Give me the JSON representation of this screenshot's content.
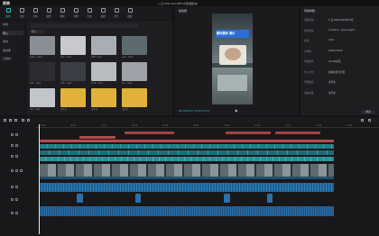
{
  "app": {
    "title": "剪映",
    "file_title": "1-云-PHN-2024年03月整理版本"
  },
  "toolbar": {
    "items": [
      {
        "label": "媒体",
        "icon": "media-icon",
        "active": true
      },
      {
        "label": "音频",
        "icon": "audio-icon"
      },
      {
        "label": "文本",
        "icon": "text-icon"
      },
      {
        "label": "贴纸",
        "icon": "sticker-icon"
      },
      {
        "label": "特效",
        "icon": "effects-icon"
      },
      {
        "label": "转场",
        "icon": "transition-icon"
      },
      {
        "label": "字幕",
        "icon": "caption-icon"
      },
      {
        "label": "滤镜",
        "icon": "filter-icon"
      },
      {
        "label": "调节",
        "icon": "adjust-icon"
      },
      {
        "label": "模板",
        "icon": "template-icon"
      }
    ]
  },
  "leftnav": {
    "items": [
      "本地",
      "导入",
      "我的",
      "素材库",
      "云素材"
    ],
    "selected_index": 1
  },
  "media": {
    "import_label": "导入",
    "thumbs": [
      {
        "name": "bdb1...mp4",
        "color": "#8a8f96"
      },
      {
        "name": "0a2...mp4",
        "color": "#c7c9cc"
      },
      {
        "name": "c89...mp4",
        "color": "#a9aeb5"
      },
      {
        "name": "ee1...mp4",
        "color": "#5d6b70"
      },
      {
        "name": "b32...mp4",
        "color": "#2b2d31"
      },
      {
        "name": "d7b...mp4",
        "color": "#3b3e44"
      },
      {
        "name": "Tm2...mp4",
        "color": "#b8bcc0"
      },
      {
        "name": "f3c...mp4",
        "color": "#9da3a9"
      },
      {
        "name": "cf0...mp4",
        "color": "#c2c6ca"
      },
      {
        "name": "文件夹",
        "color": "#e0b23a"
      },
      {
        "name": "文件夹",
        "color": "#e0b23a"
      },
      {
        "name": "文件夹",
        "color": "#e0b23a"
      }
    ]
  },
  "player": {
    "title": "播放器",
    "time": "00:00:05:12 / 00:03:21:10",
    "overlay_text": "素材替换 演示"
  },
  "details": {
    "title": "草稿参数",
    "rows": [
      {
        "label": "草稿名称：",
        "value": "1-云-PHN-2024年03月"
      },
      {
        "label": "保存位置：",
        "value": "C:/Users/.../JianyingPro"
      },
      {
        "label": "比例：",
        "value": "9:16"
      },
      {
        "label": "分辨率：",
        "value": "1080×1920"
      },
      {
        "label": "草稿帧率：",
        "value": "30.00帧/秒"
      },
      {
        "label": "导入方式：",
        "value": "保留在原有位置"
      },
      {
        "label": "代理模式：",
        "value": "未开启"
      },
      {
        "label": "自由层级：",
        "value": "未开启"
      }
    ],
    "modify_label": "修改"
  },
  "timeline": {
    "ticks": [
      "00:00",
      "00:10",
      "00:20",
      "00:30",
      "00:40",
      "00:50",
      "01:00",
      "01:10",
      "01:20",
      "01:30",
      "01:40"
    ]
  }
}
